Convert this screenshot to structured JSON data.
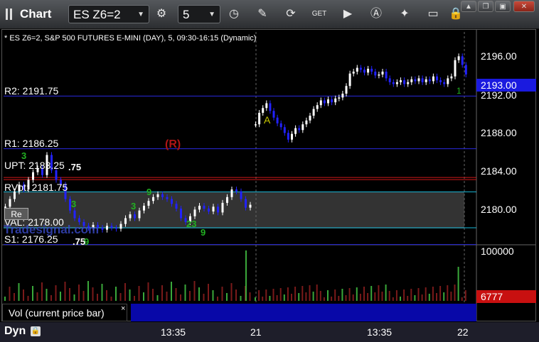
{
  "toolbar": {
    "title": "Chart",
    "symbol": "ES Z6=2",
    "interval": "5",
    "icons": [
      "grip-icon",
      "gear-icon",
      "clock-icon",
      "pencil-icon",
      "refresh-icon",
      "get-icon",
      "play-icon",
      "a-icon",
      "eraser-icon",
      "chat-icon",
      "lock-icon"
    ],
    "get_label": "GET"
  },
  "window_buttons": {
    "up": "▲",
    "restore": "❐",
    "close": "✕"
  },
  "chart": {
    "subtitle": "* ES Z6=2, S&P 500 FUTURES E-MINI (DAY), 5, 09:30-16:15 (Dynamic)",
    "last_price": "2193.00",
    "price_labels": [
      "2196.00",
      "2192.00",
      "2188.00",
      "2184.00",
      "2180.00"
    ],
    "levels": [
      {
        "label": "R2: 2191.75",
        "color": "#2a2ae0"
      },
      {
        "label": "R1: 2186.25",
        "color": "#2a2ae0"
      },
      {
        "label": "UPT: 2183.25",
        "color": "#d01818"
      },
      {
        "label": "RVpt: 2181.75",
        "color": "#18b8d8"
      },
      {
        "label": "VAL: 2178.00",
        "color": "#18b8d8"
      },
      {
        "label": "S1: 2176.25",
        "color": "#2a2ae0"
      }
    ],
    "markers": {
      "r": "(R)",
      "a": "A",
      "one": "1",
      "re": "Re"
    },
    "stray_text": {
      "n1": "3",
      "n2": "9",
      "n3": ".75",
      "n4": "3",
      "n5": "9",
      "n6": "9",
      "n7": ".75",
      "n8": "23",
      "n9": "3"
    },
    "watermark": "Tradesignal.com",
    "x_labels": [
      "13:35",
      "21",
      "13:35",
      "22"
    ]
  },
  "volume_panel": {
    "label": "Vol (current price bar)",
    "close": "×",
    "scale_label": "100000",
    "last_volume": "6777"
  },
  "status": {
    "dyn": "Dyn"
  },
  "colors": {
    "up": "#ffffff",
    "down": "#2222ff",
    "volume": "#7a1a1a",
    "volume_hi": "#3aa83a",
    "value_area": "#333333"
  }
}
